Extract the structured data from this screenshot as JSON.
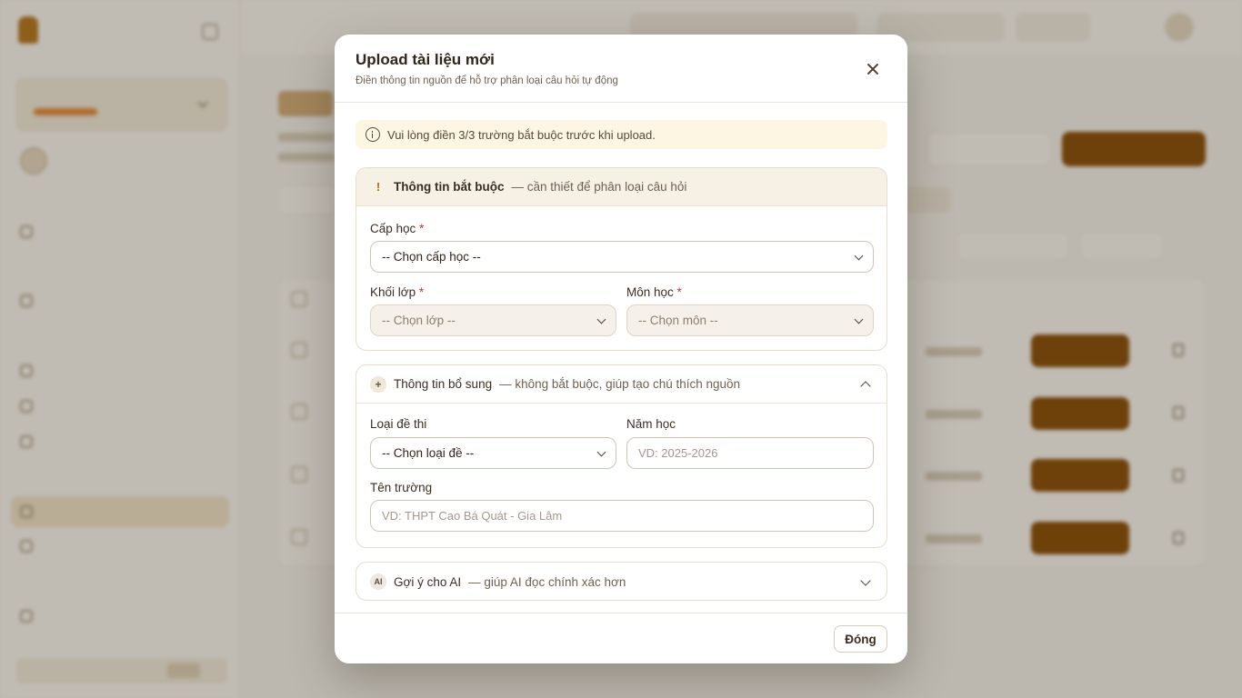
{
  "modal": {
    "title": "Upload tài liệu mới",
    "subtitle": "Điền thông tin nguồn để hỗ trợ phân loại câu hỏi tự động",
    "alert": "Vui lòng điền 3/3 trường bắt buộc trước khi upload.",
    "required_section": {
      "badge": "!",
      "title": "Thông tin bắt buộc",
      "note": "— cần thiết để phân loại câu hỏi",
      "fields": {
        "cap_hoc": {
          "label": "Cấp học",
          "required_mark": "*",
          "value": "-- Chọn cấp học --"
        },
        "khoi_lop": {
          "label": "Khối lớp",
          "required_mark": "*",
          "value": "-- Chọn lớp --"
        },
        "mon_hoc": {
          "label": "Môn học",
          "required_mark": "*",
          "value": "-- Chọn môn --"
        }
      }
    },
    "optional_section": {
      "badge": "+",
      "title": "Thông tin bổ sung",
      "note": "— không bắt buộc, giúp tạo chú thích nguồn",
      "fields": {
        "loai_de": {
          "label": "Loại đề thi",
          "value": "-- Chọn loại đề --"
        },
        "nam_hoc": {
          "label": "Năm học",
          "placeholder": "VD: 2025-2026"
        },
        "ten_truong": {
          "label": "Tên trường",
          "placeholder": "VD: THPT Cao Bá Quát - Gia Lâm"
        }
      }
    },
    "ai_section": {
      "badge": "AI",
      "title": "Gợi ý cho AI",
      "note": "— giúp AI đọc chính xác hơn"
    },
    "footer": {
      "close_label": "Đóng"
    }
  },
  "colors": {
    "accent": "#8a4d06",
    "overlay": "rgba(40,32,20,0.28)",
    "alert_bg": "#fdf6e2"
  }
}
